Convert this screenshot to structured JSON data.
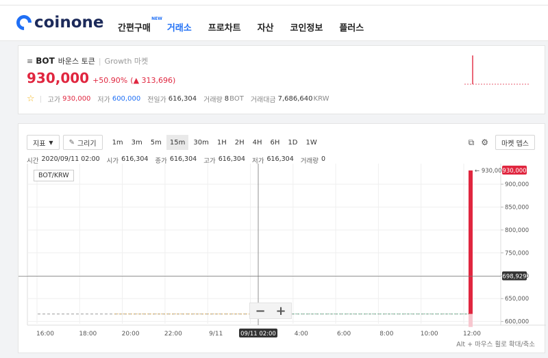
{
  "brand": {
    "name": "coinone"
  },
  "nav": {
    "items": [
      {
        "label": "간편구매",
        "badge": "NEW",
        "active": false
      },
      {
        "label": "거래소",
        "badge": "",
        "active": true
      },
      {
        "label": "프로차트",
        "badge": "",
        "active": false
      },
      {
        "label": "자산",
        "badge": "",
        "active": false
      },
      {
        "label": "코인정보",
        "badge": "",
        "active": false
      },
      {
        "label": "플러스",
        "badge": "",
        "active": false
      }
    ]
  },
  "coin": {
    "symbol": "BOT",
    "name": "바운스 토큰",
    "market": "Growth 마켓",
    "price": "930,000",
    "change_pct": "+50.90%",
    "change_abs": "313,696",
    "stats": {
      "high_label": "고가",
      "high": "930,000",
      "low_label": "저가",
      "low": "600,000",
      "prev_label": "전일가",
      "prev": "616,304",
      "volume_label": "거래량",
      "volume": "8",
      "volume_unit": "BOT",
      "amount_label": "거래대금",
      "amount": "7,686,640",
      "amount_unit": "KRW"
    }
  },
  "toolbar": {
    "indicator_label": "지표",
    "draw_label": "그리기",
    "intervals": [
      "1m",
      "3m",
      "5m",
      "15m",
      "30m",
      "1H",
      "2H",
      "4H",
      "6H",
      "1D",
      "1W"
    ],
    "active_interval": "15m",
    "market_depth_label": "마켓 뎁스"
  },
  "ohlc": {
    "time_label": "시간",
    "time": "2020/09/11 02:00",
    "open_label": "시가",
    "open": "616,304",
    "close_label": "종가",
    "close": "616,304",
    "high_label": "고가",
    "high": "616,304",
    "low_label": "저가",
    "low": "616,304",
    "vol_label": "거래량",
    "vol": "0"
  },
  "pair": "BOT/KRW",
  "hint": "Alt + 마우스 휠로 확대/축소",
  "colors": {
    "up": "#e0263f",
    "down": "#1f6ff5",
    "brand": "#1f6ff5"
  },
  "chart_data": {
    "type": "line",
    "x_ticks": [
      "16:00",
      "18:00",
      "20:00",
      "22:00",
      "9/11",
      "02:00",
      "4:00",
      "6:00",
      "8:00",
      "10:00",
      "12:00"
    ],
    "crosshair_x_label": "09/11 02:00",
    "y_ticks": [
      "900,000",
      "850,000",
      "800,000",
      "750,000",
      "700,000",
      "650,000",
      "600,000"
    ],
    "ylim": [
      595000,
      945000
    ],
    "last_price_label": "930,000",
    "hover_price_label": "698,929",
    "annotation": "930,000",
    "series": [
      {
        "values": [
          616304,
          616304,
          616304,
          616304,
          616304,
          616304,
          616304,
          616304,
          616304,
          616304,
          616304,
          616304,
          930000
        ]
      }
    ],
    "spike_candle": {
      "open": 616304,
      "high": 930000,
      "low": 600000,
      "close": 930000
    }
  }
}
